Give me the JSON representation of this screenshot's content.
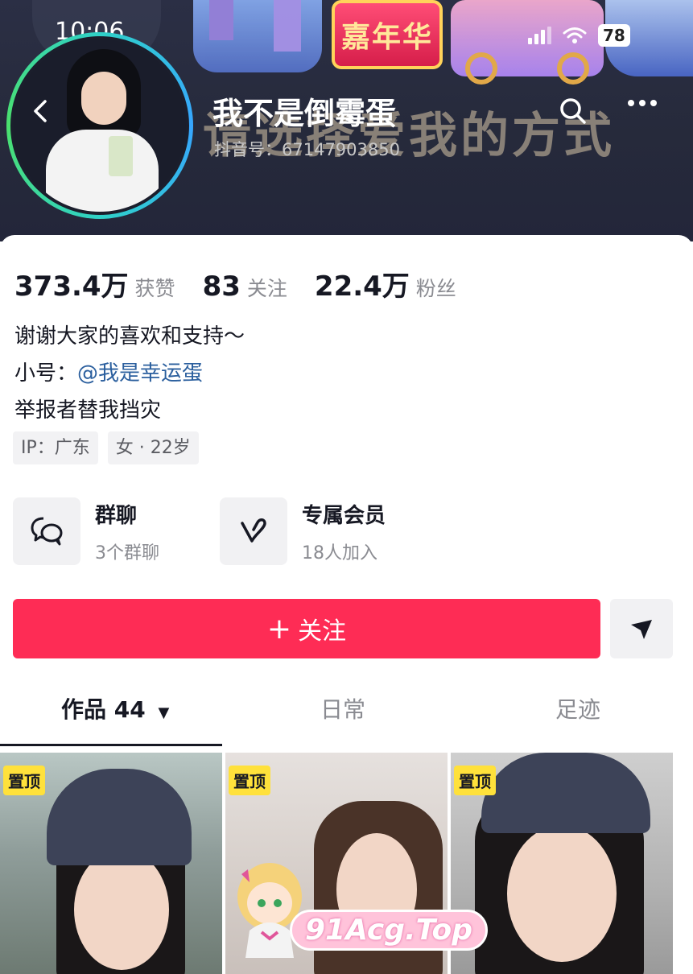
{
  "status_bar": {
    "time": "10:06",
    "battery": "78"
  },
  "header": {
    "username": "我不是倒霉蛋",
    "douyin_id": "抖音号：67147903850",
    "banner_text": "请选择爱我的方式",
    "banner_sign": "嘉年华"
  },
  "stats": [
    {
      "value": "373.4万",
      "label": "获赞"
    },
    {
      "value": "83",
      "label": "关注"
    },
    {
      "value": "22.4万",
      "label": "粉丝"
    }
  ],
  "bio": {
    "line1": "谢谢大家的喜欢和支持～",
    "line2_prefix": "小号：",
    "line2_link": "@我是幸运蛋",
    "line3": "举报者替我挡灾"
  },
  "tags": [
    "IP：广东",
    "女 · 22岁"
  ],
  "features": [
    {
      "title": "群聊",
      "sub": "3个群聊",
      "icon": "chat-bubbles-icon"
    },
    {
      "title": "专属会员",
      "sub": "18人加入",
      "icon": "heart-v-icon"
    }
  ],
  "actions": {
    "follow": "关注",
    "share_icon": "send-icon"
  },
  "tabs": [
    {
      "label": "作品 44",
      "active": true
    },
    {
      "label": "日常",
      "active": false
    },
    {
      "label": "足迹",
      "active": false
    }
  ],
  "videos": [
    {
      "pin": "置顶"
    },
    {
      "pin": "置顶"
    },
    {
      "pin": "置顶"
    }
  ],
  "watermark": "91Acg.Top",
  "colors": {
    "accent": "#fe2c55",
    "link": "#2b5f9e",
    "pin": "#ffe13b"
  }
}
